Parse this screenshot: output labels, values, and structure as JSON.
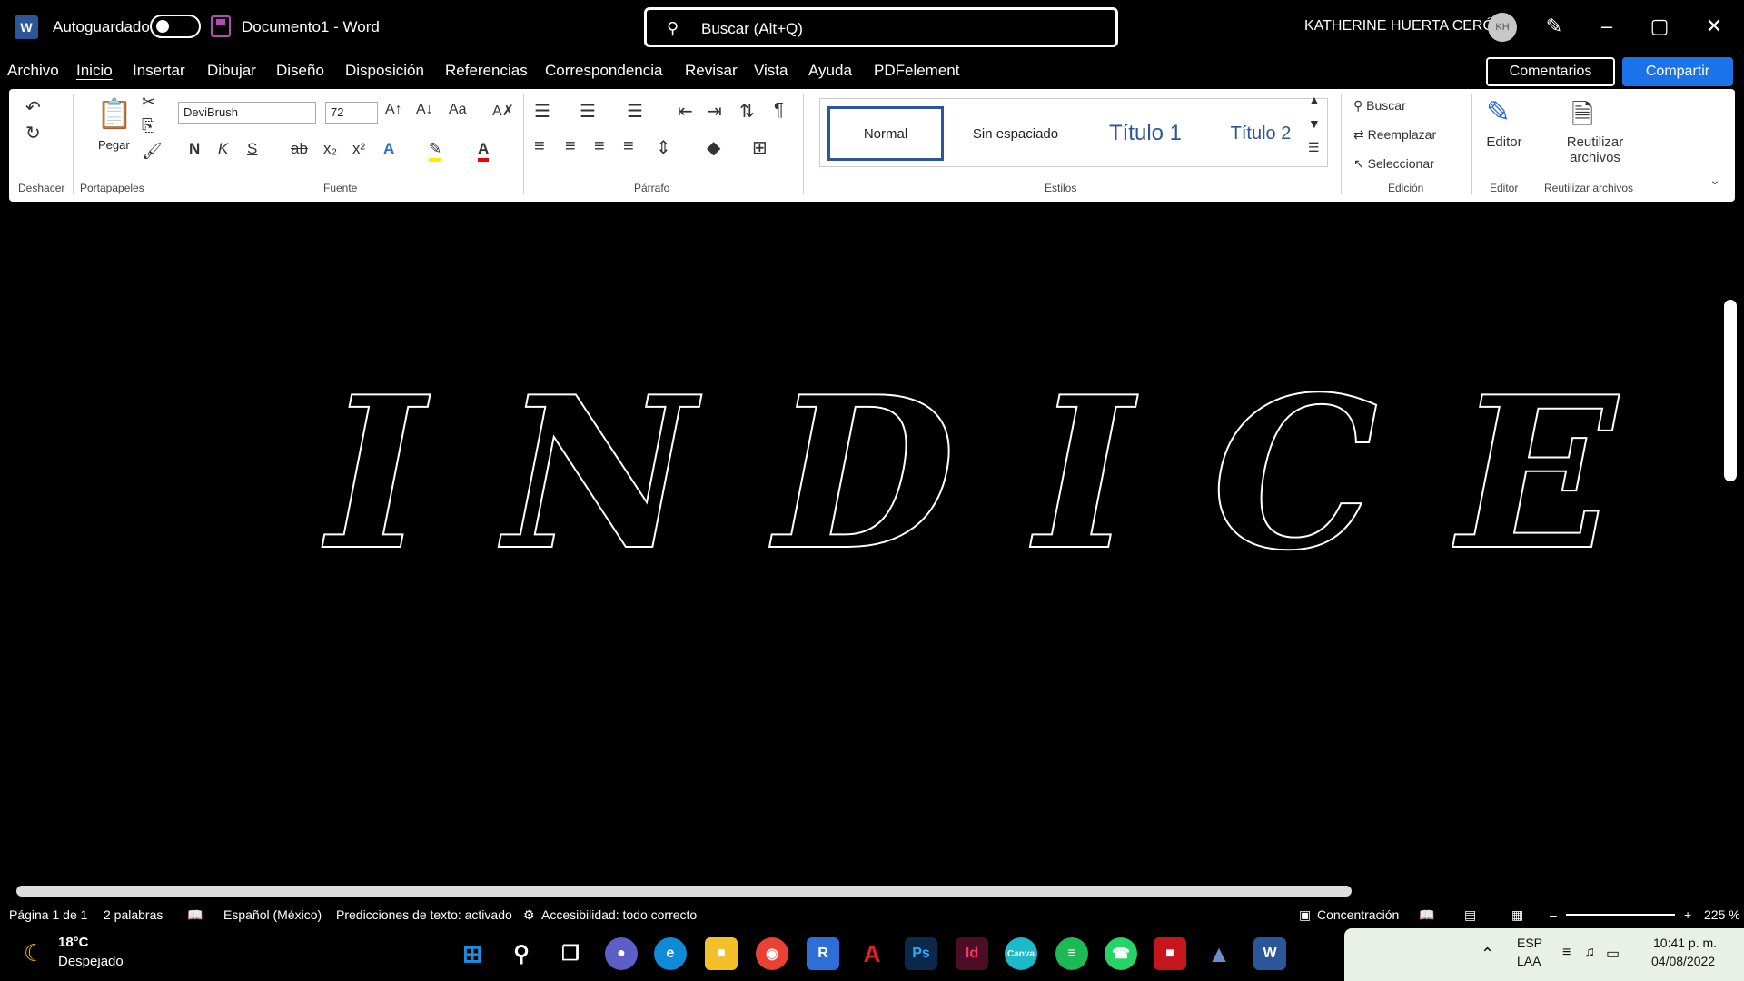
{
  "titlebar": {
    "autosave_label": "Autoguardado",
    "doc_title": "Documento1 - Word",
    "search_placeholder": "Buscar (Alt+Q)",
    "user_name": "KATHERINE HUERTA CERÓN",
    "avatar_initials": "KH"
  },
  "tabs": [
    "Archivo",
    "Inicio",
    "Insertar",
    "Dibujar",
    "Diseño",
    "Disposición",
    "Referencias",
    "Correspondencia",
    "Revisar",
    "Vista",
    "Ayuda",
    "PDFelement"
  ],
  "actions": {
    "comments": "Comentarios",
    "share": "Compartir"
  },
  "ribbon": {
    "groups": {
      "undo": "Deshacer",
      "clipboard": "Portapapeles",
      "font": "Fuente",
      "paragraph": "Párrafo",
      "styles": "Estilos",
      "editing": "Edición",
      "editor": "Editor",
      "reuse": "Reutilizar archivos"
    },
    "paste_label": "Pegar",
    "font_name": "DeviBrush",
    "font_size": "72",
    "bold": "N",
    "italic": "K",
    "underline": "S",
    "styles": [
      "Normal",
      "Sin espaciado",
      "Título 1",
      "Título 2"
    ],
    "find": "Buscar",
    "replace": "Reemplazar",
    "select": "Seleccionar",
    "editor_label": "Editor",
    "reuse_label": "Reutilizar archivos"
  },
  "document": {
    "heading_letters": [
      "I",
      "N",
      "D",
      "I",
      "C",
      "E"
    ]
  },
  "statusbar": {
    "page": "Página 1 de 1",
    "words": "2 palabras",
    "language": "Español (México)",
    "predictions": "Predicciones de texto: activado",
    "accessibility": "Accesibilidad: todo correcto",
    "focus": "Concentración",
    "zoom": "225 %"
  },
  "taskbar": {
    "weather_temp": "18°C",
    "weather_desc": "Despejado",
    "lang_top": "ESP",
    "lang_bottom": "LAA",
    "time": "10:41 p. m.",
    "date": "04/08/2022"
  }
}
